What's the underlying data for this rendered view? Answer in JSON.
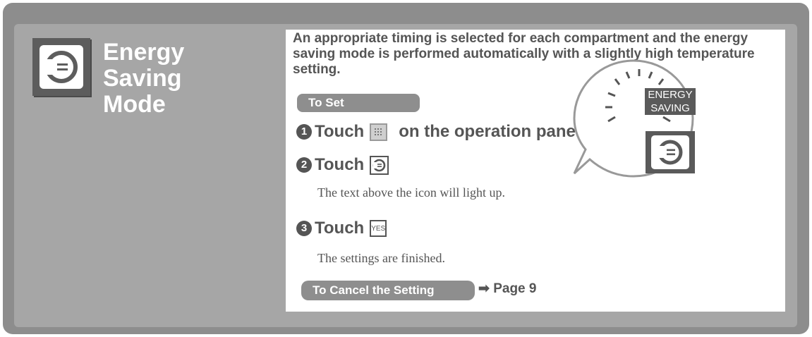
{
  "title": {
    "line1": "Energy",
    "line2": "Saving",
    "line3": "Mode"
  },
  "description": "An appropriate timing is selected for each compartment and the energy saving mode is performed automatically with a slightly high temperature setting.",
  "to_set_label": "To Set",
  "steps": [
    {
      "number": "1",
      "prefix": "Touch",
      "suffix": "on the operation panel",
      "icon": "menu-grid-icon"
    },
    {
      "number": "2",
      "prefix": "Touch",
      "suffix": "",
      "icon": "energy-saving-icon"
    },
    {
      "number": "3",
      "prefix": "Touch",
      "suffix": "",
      "icon": "yes-button-icon",
      "icon_text": "YES"
    }
  ],
  "notes": {
    "step2": "The text above the icon will light up.",
    "step3": "The settings are finished."
  },
  "cancel": {
    "label": "To Cancel the Setting",
    "reference": "Page 9"
  },
  "callout": {
    "line1": "ENERGY",
    "line2": "SAVING"
  },
  "colors": {
    "frame": "#8d8d8d",
    "panel": "#ffffff",
    "text": "#555555",
    "pill": "#8e8e8e"
  }
}
